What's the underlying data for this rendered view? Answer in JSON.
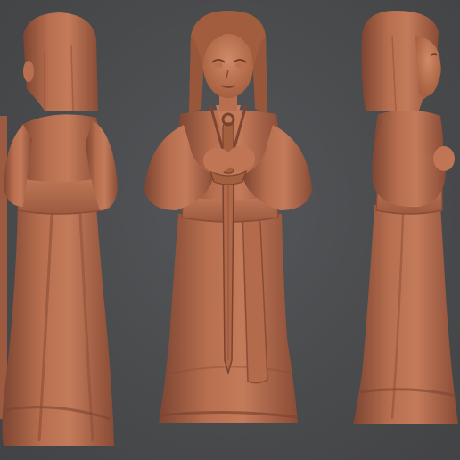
{
  "scene": {
    "background_color": "#4a4b4d",
    "clay_color": "#b0694a",
    "clay_shadow_color": "#7a4330",
    "clay_highlight_color": "#cf8a68"
  },
  "views": [
    {
      "name": "back-view",
      "icon": "figure-back-icon"
    },
    {
      "name": "front-view",
      "icon": "figure-front-icon"
    },
    {
      "name": "side-view",
      "icon": "figure-side-icon"
    }
  ]
}
